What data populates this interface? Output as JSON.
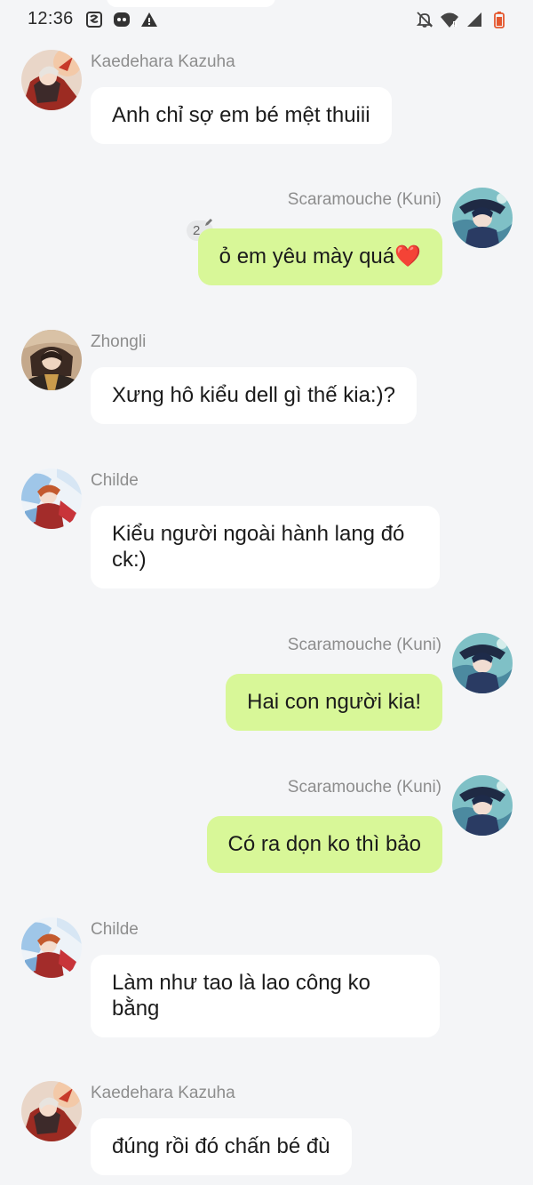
{
  "status_bar": {
    "time": "12:36",
    "left_icons": [
      "screenshot-icon",
      "messenger-bot-icon",
      "warning-icon"
    ],
    "right_icons": [
      "notifications-off-icon",
      "wifi-icon",
      "signal-icon",
      "battery-icon"
    ],
    "battery_color": "#e4572e"
  },
  "colors": {
    "background": "#f4f5f7",
    "incoming_bubble": "#ffffff",
    "outgoing_bubble": "#d8f798",
    "sender_name": "#8d8d8d"
  },
  "messages": [
    {
      "sender": "Kaedehara Kazuha",
      "side": "left",
      "text": "Anh chỉ sợ em bé mệt thuiii",
      "avatar": "kazuha-avatar"
    },
    {
      "sender": "Scaramouche (Kuni)",
      "side": "right",
      "text": "ỏ em yêu mày quá❤️",
      "avatar": "scaramouche-avatar",
      "edit_count": "2"
    },
    {
      "sender": "Zhongli",
      "side": "left",
      "text": "Xưng hô kiểu dell gì thế kia:)?",
      "avatar": "zhongli-avatar"
    },
    {
      "sender": "Childe",
      "side": "left",
      "text": "Kiểu người  ngoài hành lang đó ck:)",
      "avatar": "childe-avatar"
    },
    {
      "sender": "Scaramouche (Kuni)",
      "side": "right",
      "text": "Hai con người kia!",
      "avatar": "scaramouche-avatar"
    },
    {
      "sender": "Scaramouche (Kuni)",
      "side": "right",
      "text": "Có ra dọn ko thì bảo",
      "avatar": "scaramouche-avatar"
    },
    {
      "sender": "Childe",
      "side": "left",
      "text": "Làm như tao là lao công ko bằng",
      "avatar": "childe-avatar"
    },
    {
      "sender": "Kaedehara Kazuha",
      "side": "left",
      "text": "đúng rồi đó chấn bé đù",
      "avatar": "kazuha-avatar"
    }
  ]
}
